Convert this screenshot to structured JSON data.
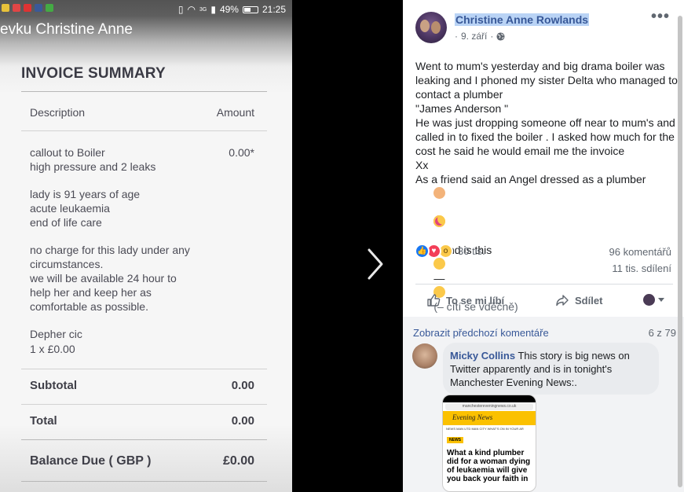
{
  "photo": {
    "statusbar": {
      "battery": "49%",
      "time": "21:25",
      "network": "3G"
    },
    "title": "evku Christine Anne",
    "invoice": {
      "heading": "INVOICE SUMMARY",
      "col_description": "Description",
      "col_amount": "Amount",
      "item_lines": [
        "callout to Boiler",
        "high pressure and 2 leaks"
      ],
      "item_amount": "0.00*",
      "notes_1": [
        "lady is 91 years of age",
        "acute leukaemia",
        "end of life care"
      ],
      "notes_2": [
        "no charge for this lady under any",
        "circumstances.",
        "we will be available 24 hour to",
        "help her and keep her as",
        "comfortable as possible."
      ],
      "signoff": [
        "Depher cic",
        "1 x £0.00"
      ],
      "subtotal_label": "Subtotal",
      "subtotal_value": "0.00",
      "total_label": "Total",
      "total_value": "0.00",
      "balance_label": "Balance Due ( GBP )",
      "balance_value": "£0.00"
    }
  },
  "post": {
    "author": "Christine Anne Rowlands",
    "date": "9. září",
    "privacy_icon": "globe-icon",
    "lines": [
      "Went to mum's yesterday and big drama boiler was leaking and I phoned my sister Delta who managed to contact a plumber",
      "\"James Anderson \"",
      "He was just dropping someone off near to mum's and called in to fixed the boiler . I asked how much for the cost he said he would email me the invoice",
      "Xx",
      "As a friend said an Angel dressed as a plumber"
    ],
    "last_line": "How kind is this",
    "feeling": "(– cítí se vděčně)",
    "reactions_count": "30 tis.",
    "comments_count": "96 komentářů",
    "shares_count": "11 tis. sdílení",
    "like_label": "To se mi líbí",
    "share_label": "Sdílet"
  },
  "comments": {
    "previous_label": "Zobrazit předchozí komentáře",
    "pager": "6 z 79",
    "first": {
      "author": "Micky Collins",
      "text": "This story is big news on Twitter apparently and is in tonight's Manchester Evening News:."
    },
    "preview": {
      "url": "manchestereveningnews.co.uk",
      "logo": "Evening News",
      "nav": "NEWS  MAN UTD  MAN CITY  WHAT'S ON  IN YOUR AR",
      "tag": "NEWS",
      "headline": "What a kind plumber did for a woman dying of leukaemia will give you back your faith in"
    }
  },
  "colors": {
    "fb_link": "#385898",
    "highlight": "#b9d3f5",
    "like_blue": "#1877f2",
    "love_red": "#f33e58",
    "wow_yellow": "#fbc94a"
  }
}
